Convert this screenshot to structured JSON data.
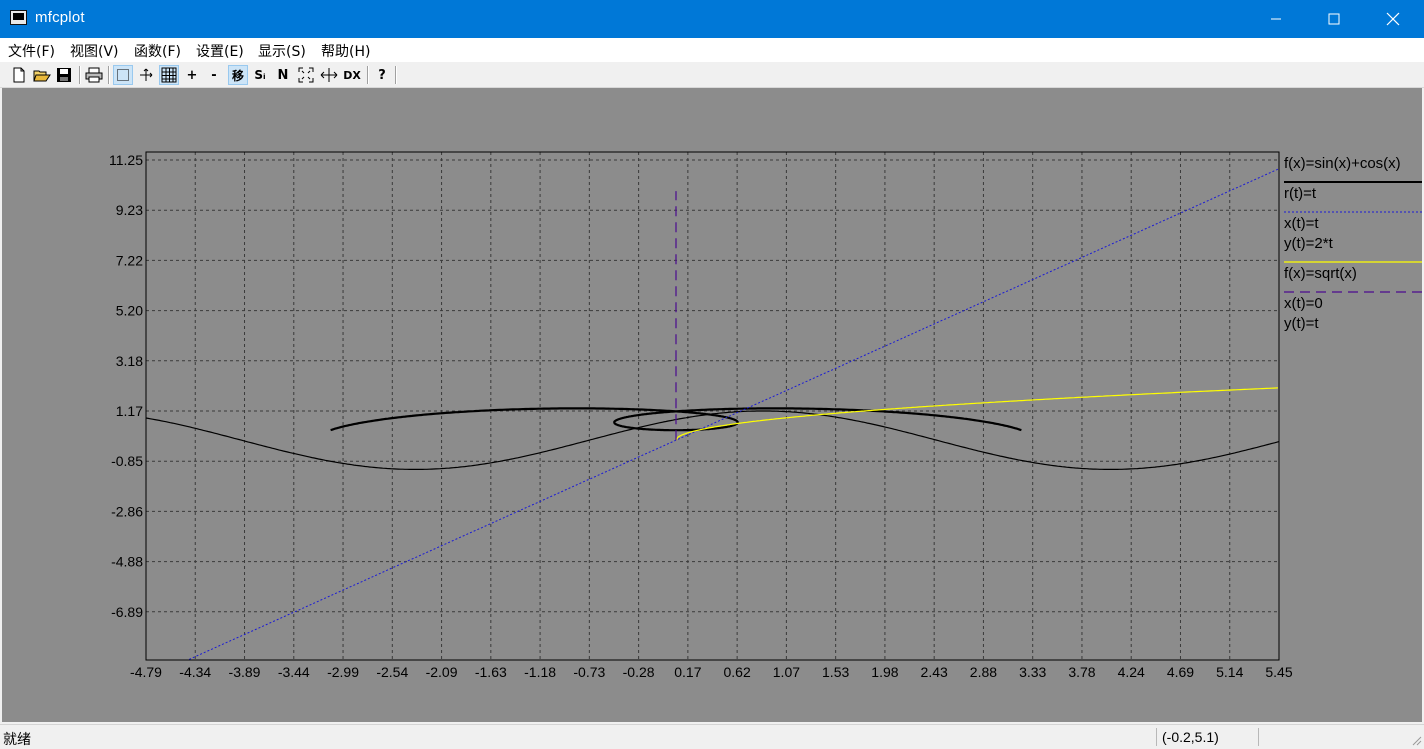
{
  "window": {
    "title": "mfcplot"
  },
  "menu": [
    {
      "label": "文件(F)"
    },
    {
      "label": "视图(V)"
    },
    {
      "label": "函数(F)"
    },
    {
      "label": "设置(E)"
    },
    {
      "label": "显示(S)"
    },
    {
      "label": "帮助(H)"
    }
  ],
  "toolbar": {
    "buttons": [
      {
        "name": "new-file-icon",
        "text": ""
      },
      {
        "name": "open-folder-icon",
        "text": ""
      },
      {
        "name": "save-icon",
        "text": ""
      },
      {
        "name": "print-icon",
        "text": ""
      },
      {
        "name": "select-icon",
        "text": "",
        "active": true
      },
      {
        "name": "move-icon",
        "text": ""
      },
      {
        "name": "grid-icon",
        "text": "",
        "active": true
      },
      {
        "name": "zoom-in-icon",
        "text": "+"
      },
      {
        "name": "zoom-out-icon",
        "text": "-"
      },
      {
        "name": "move-mode-icon",
        "text": "移",
        "active": true
      },
      {
        "name": "si-icon",
        "text": "Sᵢ"
      },
      {
        "name": "n-icon",
        "text": "N"
      },
      {
        "name": "fit-icon",
        "text": ""
      },
      {
        "name": "dx-stretch-icon",
        "text": ""
      },
      {
        "name": "dx-icon",
        "text": "DX"
      },
      {
        "name": "help-icon",
        "text": "?"
      }
    ]
  },
  "plot": {
    "x_ticks": [
      "-4.79",
      "-4.34",
      "-3.89",
      "-3.44",
      "-2.99",
      "-2.54",
      "-2.09",
      "-1.63",
      "-1.18",
      "-0.73",
      "-0.28",
      "0.17",
      "0.62",
      "1.07",
      "1.53",
      "1.98",
      "2.43",
      "2.88",
      "3.33",
      "3.78",
      "4.24",
      "4.69",
      "5.14",
      "5.45"
    ],
    "y_ticks": [
      "11.25",
      "9.23",
      "7.22",
      "5.20",
      "3.18",
      "1.17",
      "-0.85",
      "-2.86",
      "-4.88",
      "-6.89"
    ],
    "legend": [
      {
        "lines": [
          "f(x)=sin(x)+cos(x)"
        ],
        "color": "#000000",
        "style": "solid-thick"
      },
      {
        "lines": [
          "r(t)=t"
        ],
        "color": "#1a1ad6",
        "style": "dotted"
      },
      {
        "lines": [
          "x(t)=t",
          "y(t)=2*t"
        ],
        "color": "#ffff00",
        "style": "solid"
      },
      {
        "lines": [
          "f(x)=sqrt(x)"
        ],
        "color": "#4b0b8f",
        "style": "dashed"
      },
      {
        "lines": [
          "x(t)=0",
          "y(t)=t"
        ],
        "color": "",
        "style": "none"
      }
    ]
  },
  "status": {
    "text": "就绪",
    "coords": "(-0.2,5.1)"
  },
  "chart_data": {
    "type": "line",
    "xlim": [
      -4.79,
      5.45
    ],
    "ylim": [
      -8.9,
      11.25
    ],
    "grid": true,
    "grid_style": "dashed",
    "legend_placement": "right",
    "background": "#8c8c8c",
    "series": [
      {
        "name": "f(x)=sin(x)+cos(x)",
        "kind": "function",
        "expr": "sin(x)+cos(x)",
        "domain": [
          -4.79,
          5.45
        ],
        "color": "#000000",
        "style": "solid"
      },
      {
        "name": "r(t)=t",
        "kind": "polar",
        "expr": "r=t",
        "t_range": [
          -3.14,
          3.14
        ],
        "color": "#000000",
        "style": "solid-thick"
      },
      {
        "name": "x(t)=t, y(t)=2*t",
        "kind": "parametric",
        "x": "t",
        "y": "2*t",
        "domain": [
          -4.4,
          5.45
        ],
        "color": "#1a1ad6",
        "style": "dotted"
      },
      {
        "name": "f(x)=sqrt(x)",
        "kind": "function",
        "expr": "sqrt(x)",
        "domain": [
          0,
          5.45
        ],
        "color": "#ffff00",
        "style": "solid"
      },
      {
        "name": "x(t)=0, y(t)=t",
        "kind": "parametric",
        "x": "0",
        "y": "t",
        "domain": [
          0,
          10
        ],
        "color": "#4b0b8f",
        "style": "dashed"
      }
    ]
  }
}
